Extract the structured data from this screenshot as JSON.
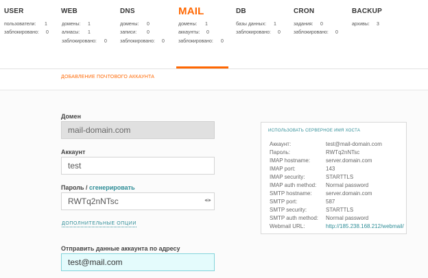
{
  "nav": [
    {
      "title": "USER",
      "stats": [
        {
          "label": "пользователи:",
          "value": "1"
        },
        {
          "label": "заблокировано:",
          "value": "0"
        }
      ]
    },
    {
      "title": "WEB",
      "stats": [
        {
          "label": "домены:",
          "value": "1"
        },
        {
          "label": "алиасы:",
          "value": "1"
        },
        {
          "label": "заблокировано:",
          "value": "0"
        }
      ]
    },
    {
      "title": "DNS",
      "stats": [
        {
          "label": "домены:",
          "value": "0"
        },
        {
          "label": "записи:",
          "value": "0"
        },
        {
          "label": "заблокировано:",
          "value": "0"
        }
      ]
    },
    {
      "title": "MAIL",
      "stats": [
        {
          "label": "домены:",
          "value": "1"
        },
        {
          "label": "аккаунты:",
          "value": "0"
        },
        {
          "label": "заблокировано:",
          "value": "0"
        }
      ]
    },
    {
      "title": "DB",
      "stats": [
        {
          "label": "базы данных:",
          "value": "1"
        },
        {
          "label": "заблокировано:",
          "value": "0"
        }
      ]
    },
    {
      "title": "CRON",
      "stats": [
        {
          "label": "задания:",
          "value": "0"
        },
        {
          "label": "заблокировано:",
          "value": "0"
        }
      ]
    },
    {
      "title": "BACKUP",
      "stats": [
        {
          "label": "архивы:",
          "value": "3"
        }
      ]
    }
  ],
  "page_title": "ДОБАВЛЕНИЕ ПОЧТОВОГО АККАУНТА",
  "form": {
    "domain_label": "Домен",
    "domain_value": "mail-domain.com",
    "account_label": "Аккаунт",
    "account_value": "test",
    "password_label": "Пароль",
    "password_sep": " / ",
    "generate_link": "сгенерировать",
    "password_value": "RWTq2nNTsc",
    "advanced_link": "ДОПОЛНИТЕЛЬНЫЕ ОПЦИИ",
    "send_label": "Отправить данные аккаунта по адресу",
    "send_value": "test@mail.com"
  },
  "info": {
    "header": "ИСПОЛЬЗОВАТЬ СЕРВЕРНОЕ ИМЯ ХОСТА",
    "rows": [
      {
        "key": "Аккаунт:",
        "value": "test@mail-domain.com"
      },
      {
        "key": "Пароль:",
        "value": "RWTq2nNTsc"
      },
      {
        "key": "IMAP hostname:",
        "value": "server.domain.com"
      },
      {
        "key": "IMAP port:",
        "value": "143"
      },
      {
        "key": "IMAP security:",
        "value": "STARTTLS"
      },
      {
        "key": "IMAP auth method:",
        "value": "Normal password"
      },
      {
        "key": "SMTP hostname:",
        "value": "server.domain.com"
      },
      {
        "key": "SMTP port:",
        "value": "587"
      },
      {
        "key": "SMTP security:",
        "value": "STARTTLS"
      },
      {
        "key": "SMTP auth method:",
        "value": "Normal password"
      },
      {
        "key": "Webmail URL:",
        "value": "http://185.238.168.212/webmail/"
      }
    ]
  },
  "colors": {
    "accent": "#ff6701",
    "link": "#2c8c96",
    "focus_bg": "#e4fbfc"
  }
}
